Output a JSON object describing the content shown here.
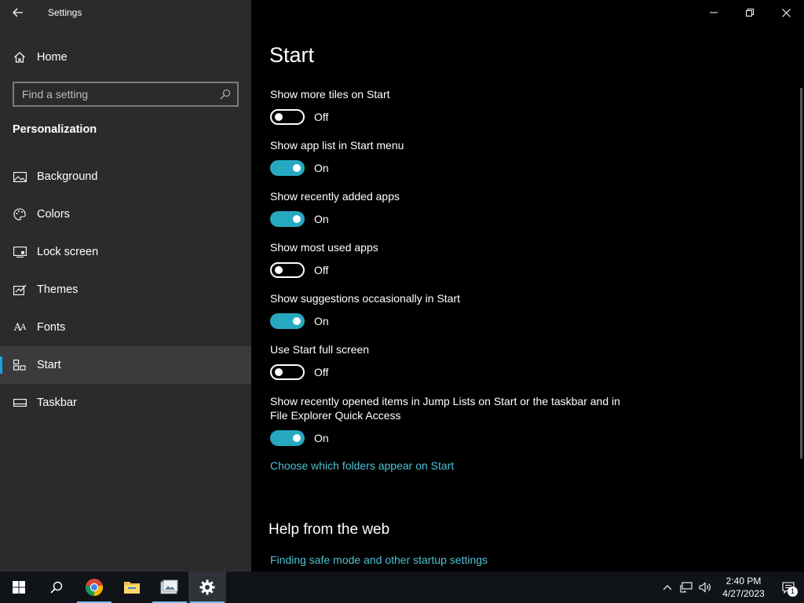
{
  "window": {
    "title": "Settings"
  },
  "sidebar": {
    "home_label": "Home",
    "search_placeholder": "Find a setting",
    "section_title": "Personalization",
    "items": [
      {
        "label": "Background",
        "icon": "picture-icon"
      },
      {
        "label": "Colors",
        "icon": "palette-icon"
      },
      {
        "label": "Lock screen",
        "icon": "lock-screen-icon"
      },
      {
        "label": "Themes",
        "icon": "themes-icon"
      },
      {
        "label": "Fonts",
        "icon": "fonts-icon"
      },
      {
        "label": "Start",
        "icon": "start-icon",
        "active": true
      },
      {
        "label": "Taskbar",
        "icon": "taskbar-icon"
      }
    ]
  },
  "main": {
    "title": "Start",
    "settings": [
      {
        "label": "Show more tiles on Start",
        "state": "Off",
        "on": false
      },
      {
        "label": "Show app list in Start menu",
        "state": "On",
        "on": true
      },
      {
        "label": "Show recently added apps",
        "state": "On",
        "on": true
      },
      {
        "label": "Show most used apps",
        "state": "Off",
        "on": false
      },
      {
        "label": "Show suggestions occasionally in Start",
        "state": "On",
        "on": true
      },
      {
        "label": "Use Start full screen",
        "state": "Off",
        "on": false
      },
      {
        "label": "Show recently opened items in Jump Lists on Start or the taskbar and in File Explorer Quick Access",
        "state": "On",
        "on": true
      }
    ],
    "folders_link": "Choose which folders appear on Start",
    "help_title": "Help from the web",
    "help_link": "Finding safe mode and other startup settings"
  },
  "taskbar": {
    "apps": [
      "windows-start-icon",
      "search-icon",
      "chrome-icon",
      "file-explorer-icon",
      "photos-icon",
      "settings-gear-icon"
    ],
    "time": "2:40 PM",
    "date": "4/27/2023",
    "notification_count": "1"
  },
  "colors": {
    "accent": "#26a9c0",
    "link": "#4cc2d4",
    "sidebar_bg": "#2b2b2b"
  }
}
